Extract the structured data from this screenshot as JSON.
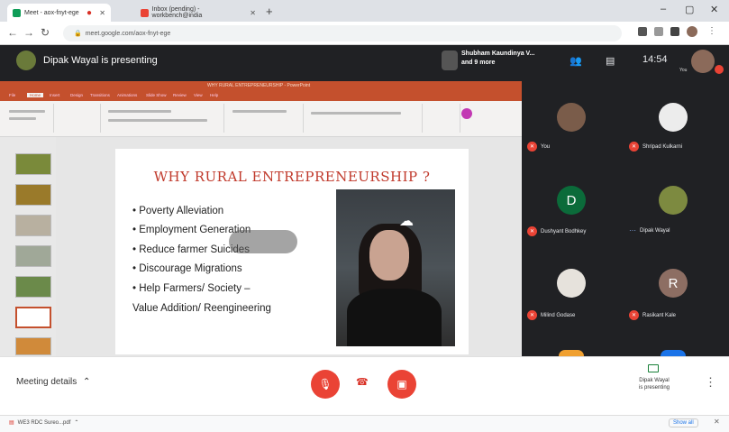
{
  "browser": {
    "tabs": [
      {
        "title": "Meet - aox-fnyt-ege",
        "favicon_color": "#0f9d58"
      },
      {
        "title": "Inbox (pending) - workbench@india",
        "favicon_color": "#ea4335"
      }
    ],
    "url": "meet.google.com/aox-fnyt-ege",
    "new_tab": "+",
    "window_controls": [
      "–",
      "▢",
      "✕"
    ]
  },
  "meet_header": {
    "presenting_text": "Dipak Wayal is presenting",
    "participants_line1": "Shubham Kaundinya V...",
    "participants_line2": "and 9 more",
    "clock": "14:54",
    "you_label": "You"
  },
  "powerpoint": {
    "title_bar": "WHY RURAL ENTREPRENEURSHIP - PowerPoint",
    "ribbon_tabs": [
      "File",
      "Home",
      "Insert",
      "Design",
      "Transitions",
      "Animations",
      "Slide Show",
      "Review",
      "View",
      "Help"
    ]
  },
  "slide": {
    "title": "WHY RURAL ENTREPRENEURSHIP ?",
    "bullets": [
      "Poverty Alleviation",
      "Employment Generation",
      "Reduce farmer Suicides",
      "Discourage Migrations",
      "Help Farmers/ Society –"
    ],
    "continuation": "Value Addition/ Reengineering"
  },
  "participants": [
    {
      "name": "You",
      "initial": "",
      "avatar_color": "#7a5c4a",
      "muted": true
    },
    {
      "name": "Shripad Kulkarni",
      "initial": "",
      "avatar_color": "#e8e8e8",
      "muted": true
    },
    {
      "name": "Dushyant Bodhkey",
      "initial": "D",
      "avatar_color": "#0b6b3a",
      "muted": true
    },
    {
      "name": "Dipak Wayal",
      "initial": "",
      "avatar_color": "#7d8a40",
      "muted": false
    },
    {
      "name": "Milind Godase",
      "initial": "",
      "avatar_color": "#e6e2dc",
      "muted": true
    },
    {
      "name": "Rasikant Kale",
      "initial": "R",
      "avatar_color": "#8d6e63",
      "muted": true
    }
  ],
  "bottom_bar": {
    "meeting_details": "Meeting details",
    "present_status_line1": "Dipak Wayal",
    "present_status_line2": "is presenting",
    "more": "⋮"
  },
  "downloads": {
    "file": "WE3 RDC Sureo...pdf",
    "show_all": "Show all",
    "close": "✕"
  }
}
